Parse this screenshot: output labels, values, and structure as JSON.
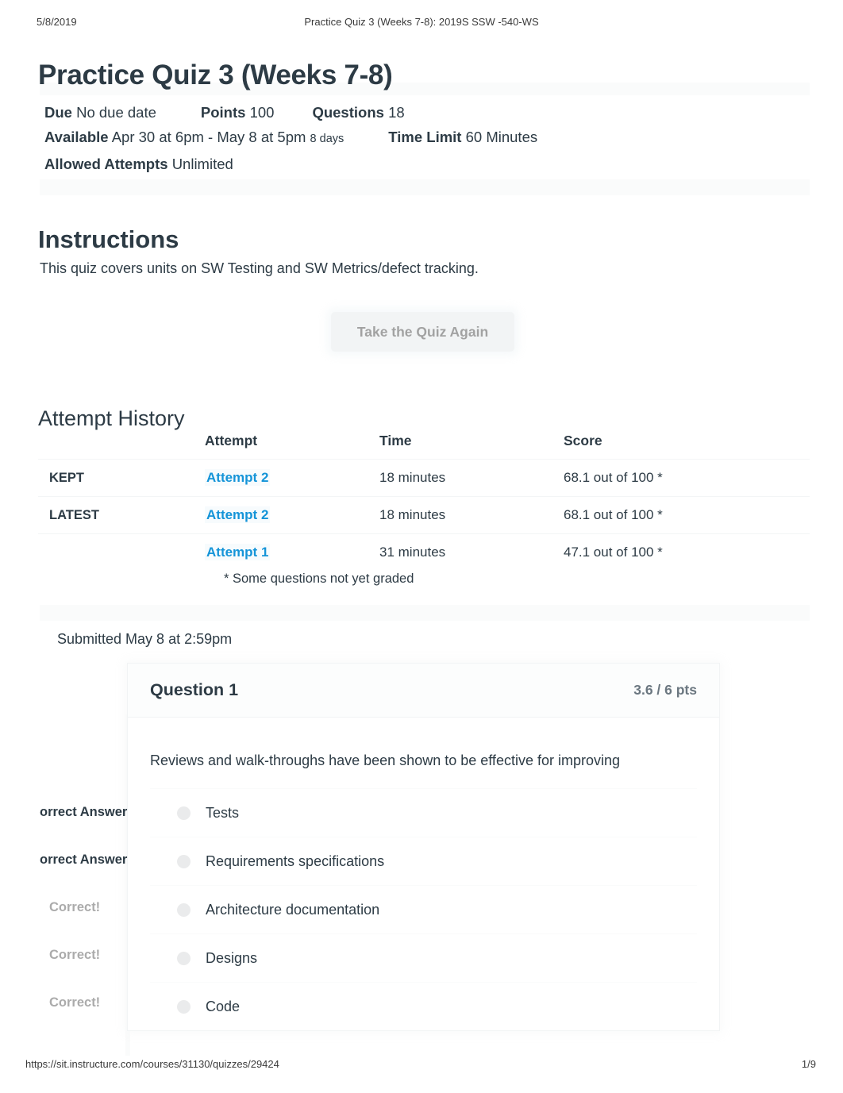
{
  "print_header": {
    "date": "5/8/2019",
    "title": "Practice Quiz 3 (Weeks 7-8): 2019S SSW -540-WS"
  },
  "page_title": "Practice Quiz 3 (Weeks 7-8)",
  "meta": {
    "due_label": "Due",
    "due_value": "No due date",
    "points_label": "Points",
    "points_value": "100",
    "questions_label": "Questions",
    "questions_value": "18",
    "available_label": "Available",
    "available_value": "Apr 30 at 6pm - May 8 at 5pm",
    "available_duration": "8 days",
    "time_limit_label": "Time Limit",
    "time_limit_value": "60 Minutes",
    "attempts_label": "Allowed Attempts",
    "attempts_value": "Unlimited"
  },
  "instructions": {
    "heading": "Instructions",
    "text": "This quiz covers units on SW Testing and SW Metrics/defect tracking."
  },
  "take_again_button": "Take the Quiz Again",
  "attempt_history": {
    "heading": "Attempt History",
    "columns": {
      "flag": "",
      "attempt": "Attempt",
      "time": "Time",
      "score": "Score"
    },
    "rows": [
      {
        "flag": "KEPT",
        "attempt": "Attempt 2",
        "time": "18 minutes",
        "score": "68.1 out of 100 *"
      },
      {
        "flag": "LATEST",
        "attempt": "Attempt 2",
        "time": "18 minutes",
        "score": "68.1 out of 100 *"
      },
      {
        "flag": "",
        "attempt": "Attempt 1",
        "time": "31 minutes",
        "score": "47.1 out of 100 *"
      }
    ],
    "note": "* Some questions not yet graded"
  },
  "submitted": "Submitted May 8 at 2:59pm",
  "question": {
    "label": "Question 1",
    "points": "3.6 / 6 pts",
    "text": "Reviews and walk-throughs have been shown to be effective for improving",
    "answers": [
      {
        "status": "orrect Answer",
        "status_style": "dark",
        "text": "Tests"
      },
      {
        "status": "orrect Answer",
        "status_style": "dark",
        "text": "Requirements specifications"
      },
      {
        "status": "Correct!",
        "status_style": "light",
        "text": "Architecture documentation"
      },
      {
        "status": "Correct!",
        "status_style": "light",
        "text": "Designs"
      },
      {
        "status": "Correct!",
        "status_style": "light",
        "text": "Code"
      }
    ]
  },
  "print_footer": {
    "url": "https://sit.instructure.com/courses/31130/quizzes/29424",
    "page": "1/9"
  },
  "colors": {
    "link_blue": "#1494d8",
    "text": "#2d3b45",
    "muted": "#6b7780",
    "light_status": "#ababab",
    "button_bg": "#f1f4f5",
    "button_text": "#9b9b9b"
  }
}
